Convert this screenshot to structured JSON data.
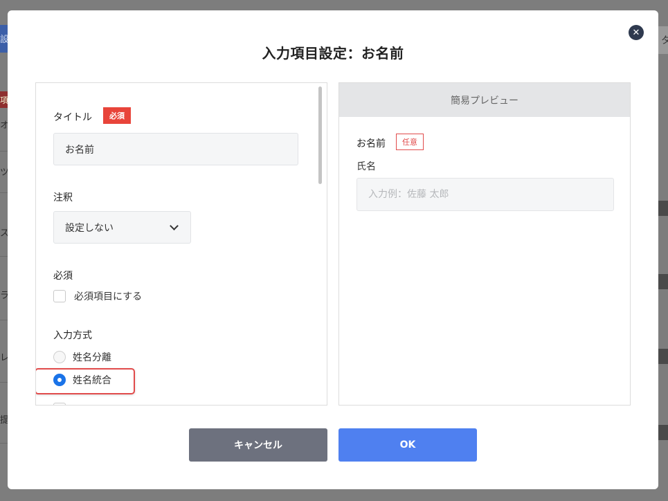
{
  "modal": {
    "title": "入力項目設定：お名前",
    "close_symbol": "✕"
  },
  "settings": {
    "title_label": "タイトル",
    "required_badge": "必須",
    "title_value": "お名前",
    "note_label": "注釈",
    "note_selected": "設定しない",
    "required_label": "必須",
    "required_checkbox_label": "必須項目にする",
    "input_method_label": "入力方式",
    "radio_options": [
      {
        "label": "姓名分離",
        "checked": false
      },
      {
        "label": "姓名統合",
        "checked": true
      }
    ]
  },
  "preview": {
    "header": "簡易プレビュー",
    "field_label": "お名前",
    "optional_badge": "任意",
    "sub_label": "氏名",
    "placeholder": "入力例：佐藤 太郎"
  },
  "footer": {
    "cancel_label": "キャンセル",
    "ok_label": "OK"
  },
  "background": {
    "left_blue_tab": "設",
    "left_red_tab": "項",
    "left_text_1": "オ",
    "left_text_2": "ツ",
    "left_text_3": "ス",
    "left_text_4": "ラ",
    "left_text_5": "レ",
    "left_text_6": "提",
    "right_tab": "タ"
  },
  "colors": {
    "accent_blue": "#4f80f0",
    "radio_blue": "#1a73e8",
    "required_red": "#e8443a",
    "highlight_red": "#e14b4b",
    "cancel_gray": "#6d717e",
    "close_navy": "#2f3a4f"
  }
}
